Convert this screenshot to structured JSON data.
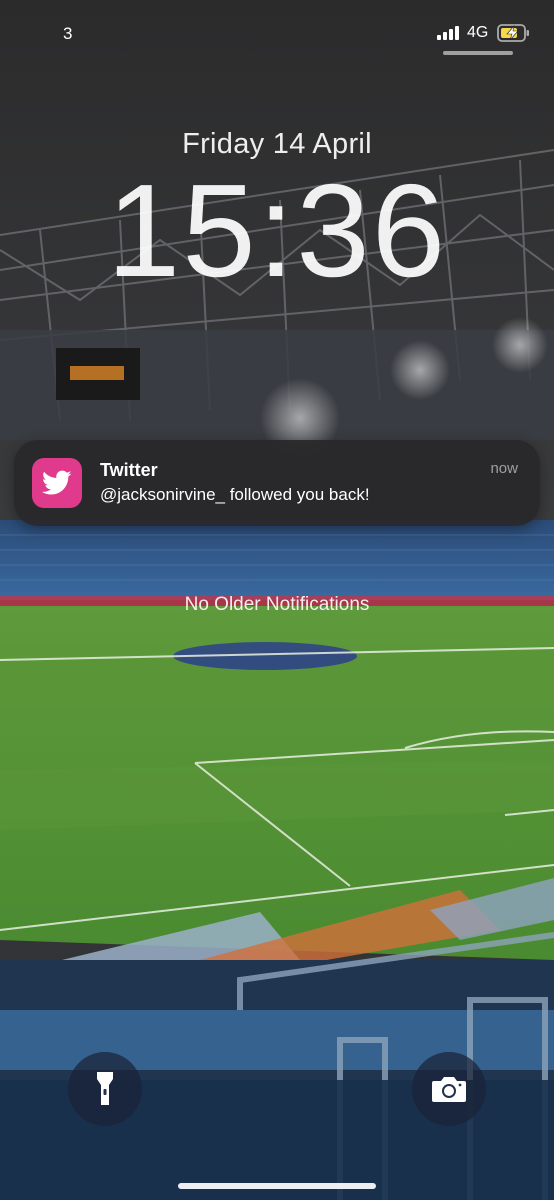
{
  "status_bar": {
    "carrier_label": "3",
    "network_type": "4G",
    "battery_state": "charging",
    "icons": [
      "signal-bars-icon",
      "battery-charging-icon"
    ]
  },
  "lock_screen": {
    "date": "Friday 14 April",
    "time": "15:36",
    "no_older_notifications": "No Older Notifications"
  },
  "notification": {
    "app_name": "Twitter",
    "message": "@jacksonirvine_ followed you back!",
    "timestamp": "now",
    "icon": "twitter-bird-icon",
    "accent_color": "#e03a8d"
  },
  "quick_actions": {
    "left": "flashlight-icon",
    "right": "camera-icon"
  }
}
